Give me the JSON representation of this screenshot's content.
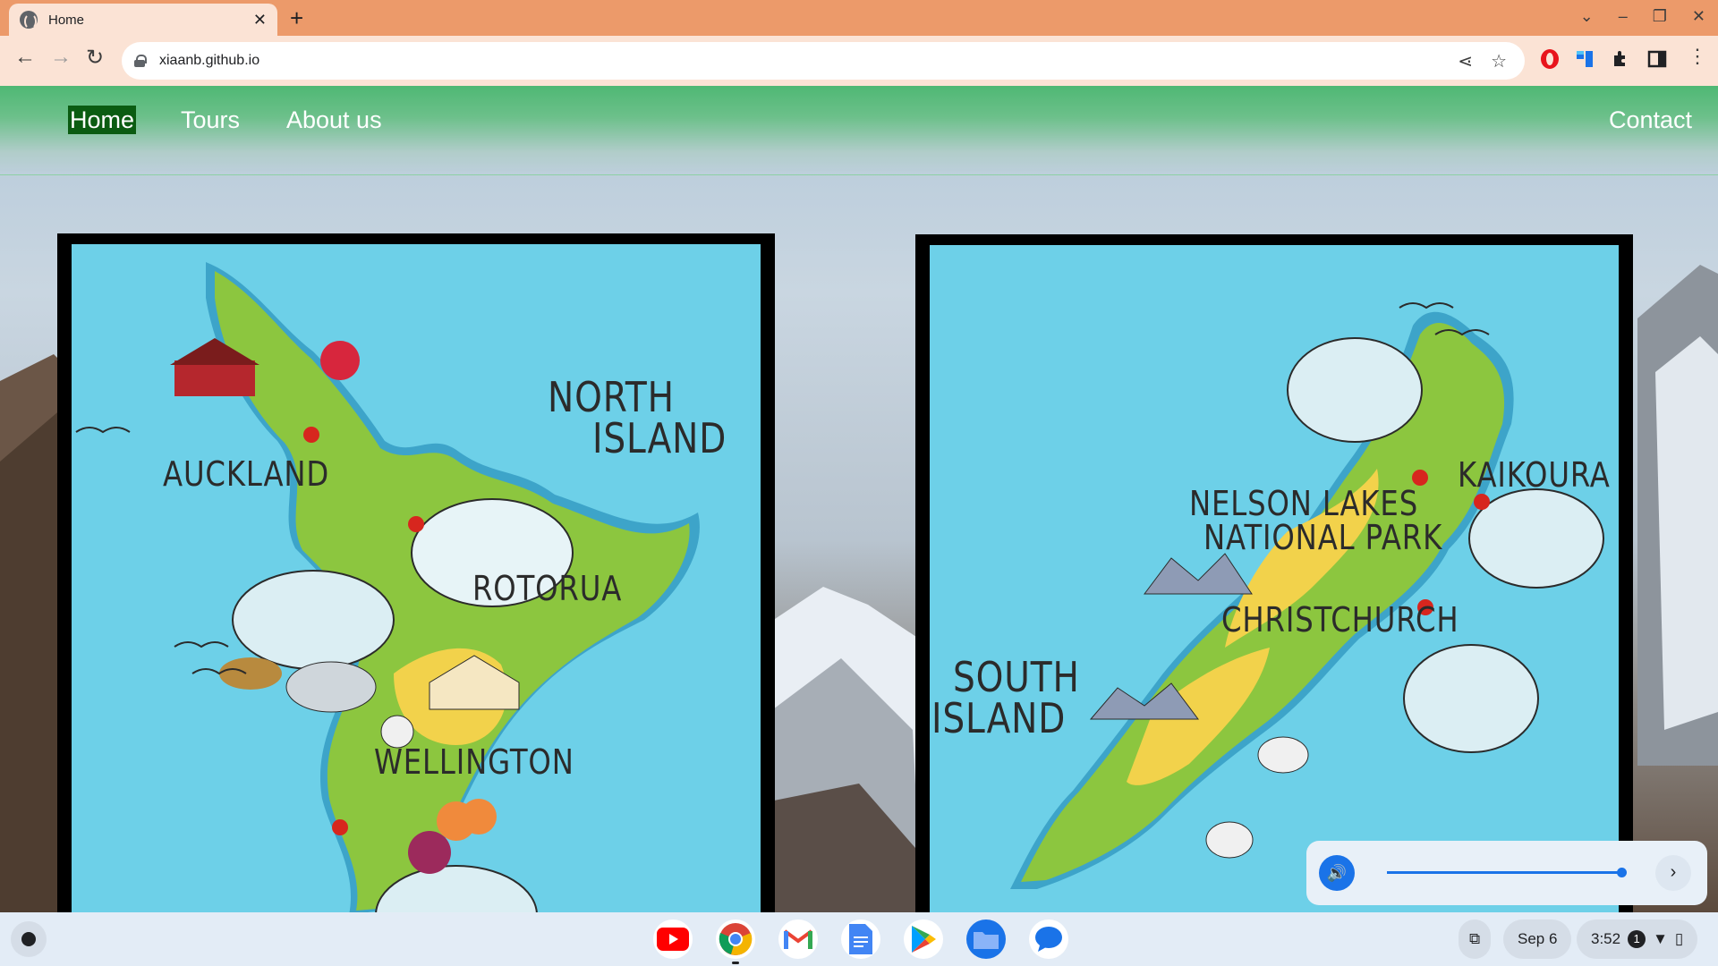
{
  "browser": {
    "tab_title": "Home",
    "new_tab_symbol": "+",
    "url": "xiaanb.github.io"
  },
  "site": {
    "nav": {
      "home": "Home",
      "tours": "Tours",
      "about": "About us",
      "contact": "Contact"
    },
    "north_map": {
      "title_line1": "NORTH",
      "title_line2": "ISLAND",
      "auckland": "AUCKLAND",
      "rotorua": "ROTORUA",
      "wellington": "WELLINGTON"
    },
    "south_map": {
      "nelson_line1": "NELSON LAKES",
      "nelson_line2": "NATIONAL PARK",
      "kaikoura": "KAIKOURA",
      "christchurch": "CHRISTCHURCH",
      "title_line1": "SOUTH",
      "title_line2": "ISLAND"
    },
    "colors": {
      "nav_green": "#4fb874",
      "active_green": "#0b5c12",
      "ocean": "#6dd0e8",
      "land": "#8cc63f",
      "highlight": "#f2d24b"
    }
  },
  "media_controls": {
    "volume_level": 0.95,
    "next_symbol": "›"
  },
  "shelf": {
    "date": "Sep 6",
    "time": "3:52",
    "notification_count": "1",
    "apps": [
      "youtube-icon",
      "chrome-icon",
      "gmail-icon",
      "docs-icon",
      "play-store-icon",
      "files-icon",
      "messages-icon"
    ]
  }
}
